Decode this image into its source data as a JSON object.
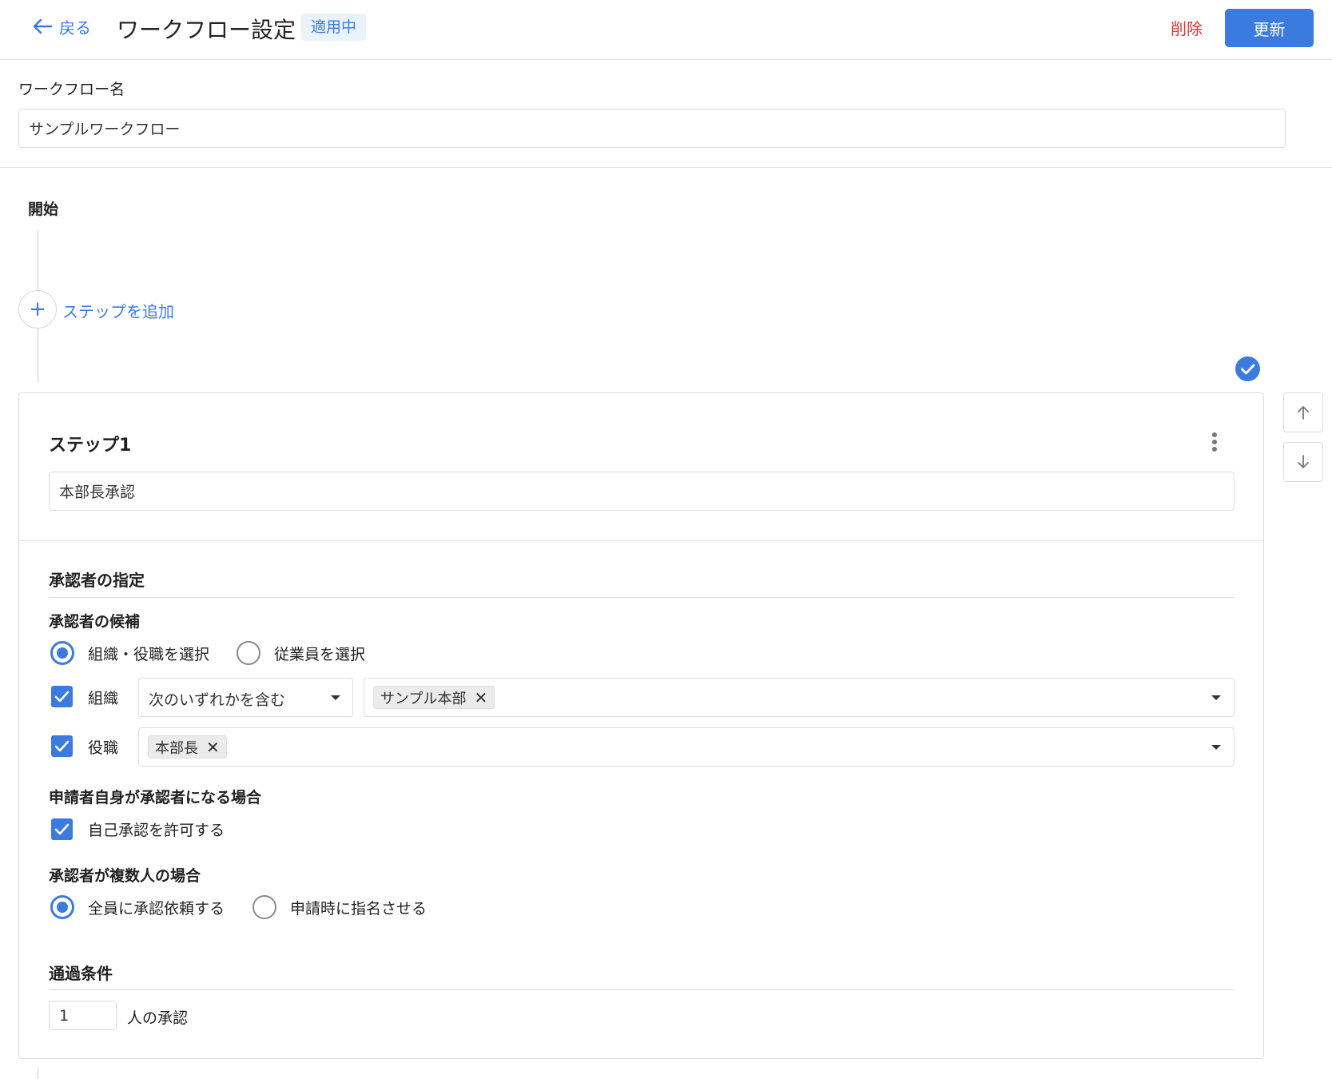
{
  "header": {
    "back_label": "戻る",
    "title": "ワークフロー設定",
    "status": "適用中",
    "delete_label": "削除",
    "update_label": "更新"
  },
  "workflow": {
    "name_label": "ワークフロー名",
    "name_value": "サンプルワークフロー"
  },
  "timeline": {
    "start_label": "開始",
    "add_step_label": "ステップを追加"
  },
  "step": {
    "title": "ステップ1",
    "name_value": "本部長承認",
    "approver_section": "承認者の指定",
    "candidates_label": "承認者の候補",
    "candidate_options": [
      "組織・役職を選択",
      "従業員を選択"
    ],
    "candidate_selected": "組織・役職を選択",
    "org_label": "組織",
    "org_condition": "次のいずれかを含む",
    "org_chip": "サンプル本部",
    "role_label": "役職",
    "role_chip": "本部長",
    "self_section": "申請者自身が承認者になる場合",
    "self_option": "自己承認を許可する",
    "multi_section": "承認者が複数人の場合",
    "multi_options": [
      "全員に承認依頼する",
      "申請時に指名させる"
    ],
    "multi_selected": "全員に承認依頼する",
    "pass_section": "通過条件",
    "pass_count": "1",
    "pass_suffix": "人の承認"
  },
  "colors": {
    "accent": "#3b7be0",
    "danger": "#e0362f",
    "badge_bg": "#eaf3fb"
  }
}
